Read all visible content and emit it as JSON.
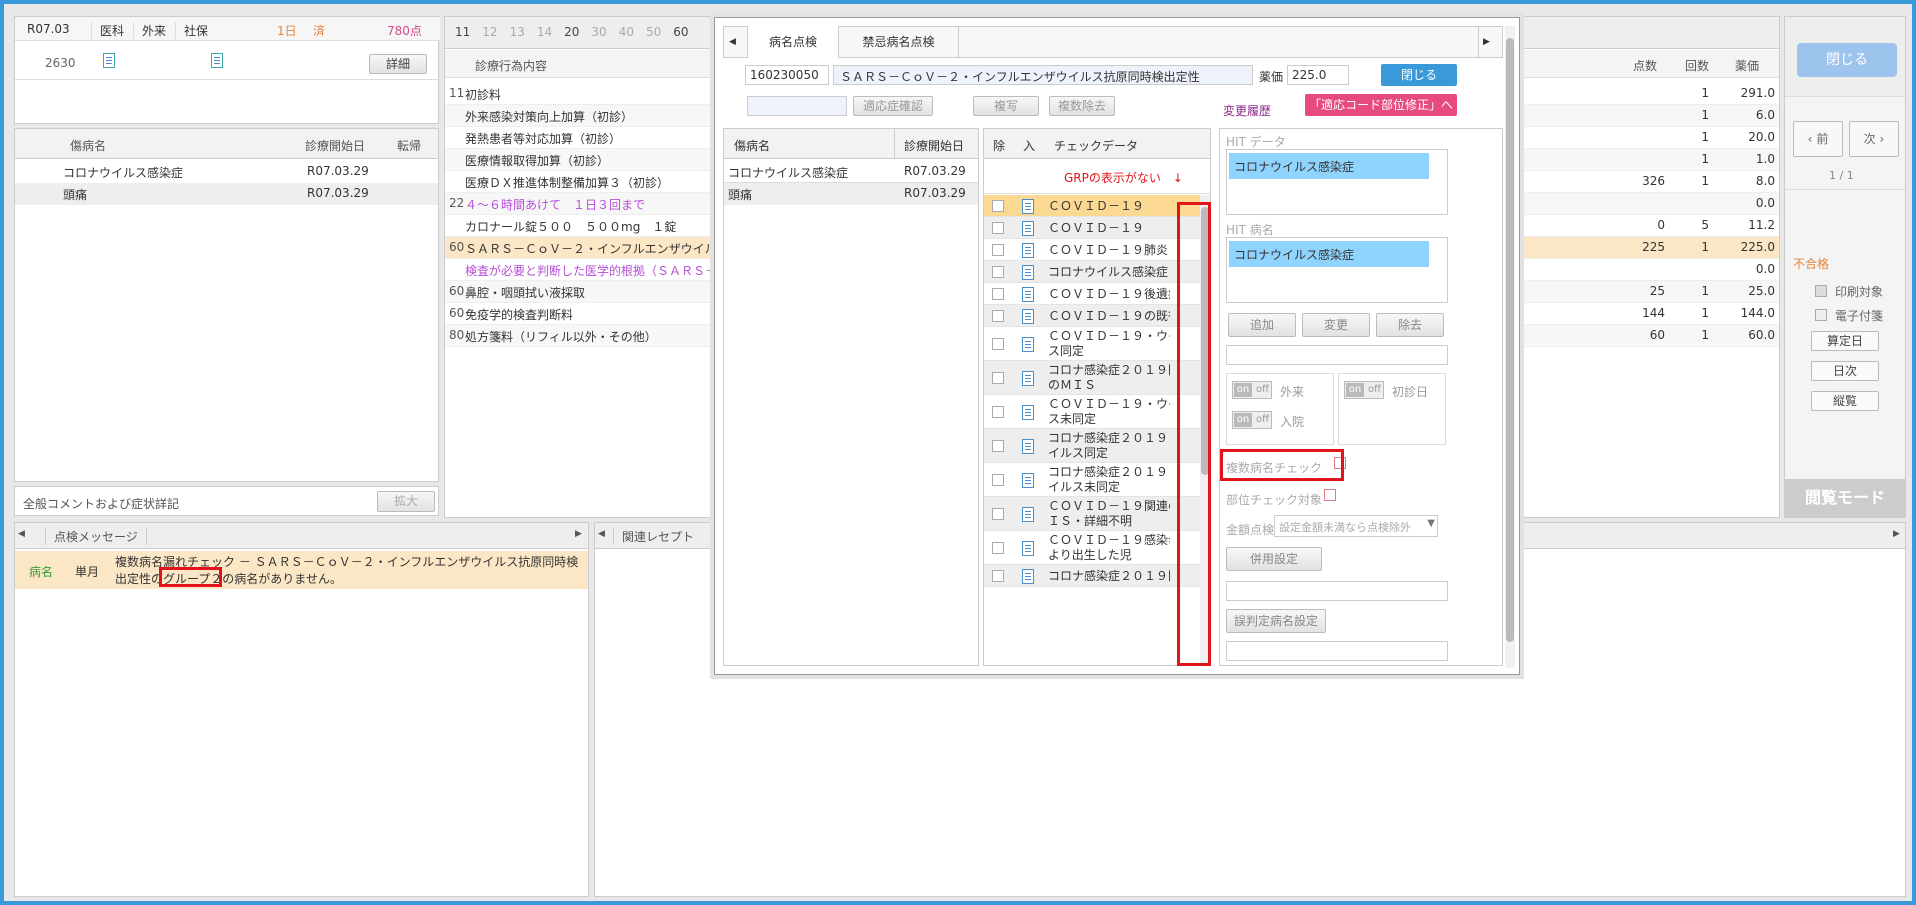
{
  "patient": {
    "date": "R07.03",
    "dept": "医科",
    "type": "外来",
    "insurance": "社保",
    "days": "1日",
    "status": "済",
    "points": "780点",
    "code": "2630",
    "detail_button": "詳細"
  },
  "disease_table": {
    "headers": [
      "傷病名",
      "診療開始日",
      "転帰"
    ],
    "rows": [
      {
        "name": "コロナウイルス感染症",
        "date": "R07.03.29"
      },
      {
        "name": "頭痛",
        "date": "R07.03.29"
      }
    ]
  },
  "comment": {
    "label": "全般コメントおよび症状詳記",
    "expand_button": "拡大"
  },
  "treatment": {
    "tabs": [
      "11",
      "12",
      "13",
      "14",
      "20",
      "30",
      "40",
      "50",
      "60"
    ],
    "header": "診療行為内容",
    "col_points": "点数",
    "col_count": "回数",
    "col_price": "薬価",
    "rows": [
      {
        "code": "11",
        "text": "初診料",
        "points": "",
        "count": "1",
        "price": "291.0",
        "style": "normal"
      },
      {
        "code": "",
        "text": "外来感染対策向上加算（初診）",
        "points": "",
        "count": "1",
        "price": "6.0",
        "style": "normal"
      },
      {
        "code": "",
        "text": "発熱患者等対応加算（初診）",
        "points": "",
        "count": "1",
        "price": "20.0",
        "style": "normal"
      },
      {
        "code": "",
        "text": "医療情報取得加算（初診）",
        "points": "",
        "count": "1",
        "price": "1.0",
        "style": "normal"
      },
      {
        "code": "",
        "text": "医療ＤＸ推進体制整備加算３（初診）",
        "points": "326",
        "count": "1",
        "price": "8.0",
        "style": "normal"
      },
      {
        "code": "22",
        "text": "４～６時間あけて　１日３回まで",
        "points": "",
        "count": "",
        "price": "0.0",
        "style": "purple"
      },
      {
        "code": "",
        "text": "カロナール錠５００　５００mg　１錠",
        "points": "0",
        "count": "5",
        "price": "11.2",
        "style": "normal"
      },
      {
        "code": "60",
        "text": "ＳＡＲＳ－ＣｏＶ－２・インフルエンザウイル",
        "points": "225",
        "count": "1",
        "price": "225.0",
        "style": "highlight"
      },
      {
        "code": "",
        "text": "検査が必要と判断した医学的根拠（ＳＡＲＳ－",
        "points": "",
        "count": "",
        "price": "0.0",
        "style": "purple"
      },
      {
        "code": "60",
        "text": "鼻腔・咽頭拭い液採取",
        "points": "25",
        "count": "1",
        "price": "25.0",
        "style": "normal"
      },
      {
        "code": "60",
        "text": "免疫学的検査判断料",
        "points": "144",
        "count": "1",
        "price": "144.0",
        "style": "normal"
      },
      {
        "code": "80",
        "text": "処方箋料（リフィル以外・その他）",
        "points": "60",
        "count": "1",
        "price": "60.0",
        "style": "normal"
      }
    ]
  },
  "right_panel": {
    "close_button": "閉じる",
    "prev_button": "前",
    "next_button": "次",
    "page": "1 / 1",
    "fail_label": "不合格",
    "print_label": "印刷対象",
    "electronic_label": "電子付箋",
    "calc_date_button": "算定日",
    "daily_button": "日次",
    "vertical_button": "縦覧",
    "view_mode": "閲覧モード"
  },
  "messages": {
    "tab": "点検メッセージ",
    "col_type": "病名",
    "col_period": "単月",
    "line1": "複数病名漏れチェック － ＳＡＲＳ－ＣｏＶ－２・インフルエンザウイルス抗原同時検",
    "line2_pre": "出定性の",
    "line2_group": "グループ２",
    "line2_post": "の病名がありません。",
    "related_tab": "関連レセプト"
  },
  "dialog": {
    "tab1": "病名点検",
    "tab2": "禁忌病名点検",
    "code": "160230050",
    "name": "ＳＡＲＳ－ＣｏＶ－２・インフルエンザウイルス抗原同時検出定性",
    "price_label": "薬価",
    "price": "225.0",
    "close_button": "閉じる",
    "indication_button": "適応症確認",
    "copy_button": "複写",
    "multi_remove_button": "複数除去",
    "history_link": "変更履歴",
    "fix_button": "「適応コード部位修正」へ",
    "disease_headers": [
      "傷病名",
      "診療開始日"
    ],
    "diseases": [
      {
        "name": "コロナウイルス感染症",
        "date": "R07.03.29"
      },
      {
        "name": "頭痛",
        "date": "R07.03.29"
      }
    ],
    "check_headers": [
      "除",
      "入",
      "チェックデータ"
    ],
    "annotation": "GRPの表示がない　↓",
    "check_rows": [
      "ＣＯＶＩＤ－１９",
      "ＣＯＶＩＤ－１９",
      "ＣＯＶＩＤ－１９肺炎",
      "コロナウイルス感染症",
      "ＣＯＶＩＤ－１９後遺症",
      "ＣＯＶＩＤ－１９の既往",
      "ＣＯＶＩＤ－１９・ウイル\nス同定",
      "コロナ感染症２０１９関連\nのＭＩＳ",
      "ＣＯＶＩＤ－１９・ウイル\nス未同定",
      "コロナ感染症２０１９・ウ\nイルス同定",
      "コロナ感染症２０１９・ウ\nイルス未同定",
      "ＣＯＶＩＤ－１９関連のＭ\nＩＳ・詳細不明",
      "ＣＯＶＩＤ－１９感染母体\nより出生した児",
      "コロナ感染症２０１９関連"
    ],
    "hit_data_label": "HIT データ",
    "hit_data_value": "コロナウイルス感染症",
    "hit_name_label": "HIT 病名",
    "hit_name_value": "コロナウイルス感染症",
    "add_button": "追加",
    "change_button": "変更",
    "remove_button": "除去",
    "toggle_on": "on",
    "toggle_off": "off",
    "outpatient_label": "外来",
    "inpatient_label": "入院",
    "first_visit_label": "初診日",
    "multi_check_label": "複数病名チェック",
    "site_check_label": "部位チェック対象",
    "amount_label": "金額点検",
    "amount_select": "設定金額未満なら点検除外",
    "combined_button": "併用設定",
    "misjudge_button": "誤判定病名設定"
  }
}
